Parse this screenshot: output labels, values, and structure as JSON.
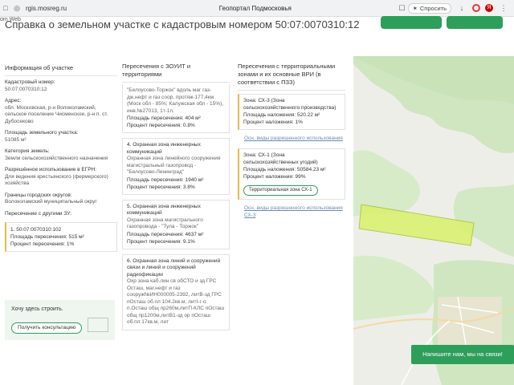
{
  "browser": {
    "url": "rgis.mosreg.ru",
    "tab_title": "Геопортал Подмосковья",
    "save_label": "Спросить",
    "web_label": "om Web"
  },
  "page": {
    "title": "Справка о земельном участке с кадастровым номером 50:07:0070310:12"
  },
  "col1": {
    "heading": "Информация об участке",
    "fields": [
      {
        "label": "Кадастровый номер:",
        "value": "50:07:0070310:12"
      },
      {
        "label": "Адрес:",
        "value": "обл. Московская, р-н Волоколамский, сельское поселение Чисменское, р-н п. ст. Дубосеково"
      },
      {
        "label": "Площадь земельного участка:",
        "value": "51085 м²"
      },
      {
        "label": "Категория земель:",
        "value": "Земли сельскохозяйственного назначения"
      },
      {
        "label": "Разрешённое использование в ЕГРН:",
        "value": "Для ведения крестьянского (фермерского) хозяйства"
      },
      {
        "label": "Границы городских округов:",
        "value": "Волоколамский муниципальный округ"
      }
    ],
    "overlap_title": "Пересечение с другими ЗУ:",
    "overlap_card": {
      "id": "1. 50:07:0070310:102",
      "area": "Площадь пересечения: 515 м²",
      "pct": "Процент пересечения: 1%"
    },
    "consult_text": "Хочу здесь строить.",
    "consult_button": "Получить консультацию"
  },
  "col2": {
    "heading": "Пересечения с ЗОУИТ и территориями",
    "cards": [
      {
        "title": "",
        "desc": "\"Белоусово-Торжок\" вдоль маг газ-дж.нефт и газ соор, протяж-177,4км (Моск обл - 85%; Калужская обл - 15%), инв.№27013, 1т-1п.",
        "area": "Площадь пересечения: 404 м²",
        "pct": "Процент пересечения: 0.8%"
      },
      {
        "title": "4. Охранная зона инженерных коммуникаций",
        "desc": "Охранная зона линейного сооружения магистральный газопровод - \"Белоусово-Ленинград\"",
        "area": "Площадь пересечения: 1940 м²",
        "pct": "Процент пересечения: 3.8%"
      },
      {
        "title": "5. Охранная зона инженерных коммуникаций",
        "desc": "Охранная зона магистрального газопровода - \"Тула - Торжок\"",
        "area": "Площадь пересечения: 4637 м²",
        "pct": "Процент пересечения: 9.1%"
      },
      {
        "title": "6. Охранная зона линий и сооружений связи и линий и сооружений радиофикации",
        "desc": "Охр зона каб.лин св обСТО и зд ГРС Осташ, маг.нефт и газ сооруж№ИН000005-2392, литВ-зд ГРС пОсташ об.пл 104.2кв.м, литI-г-о п.Осташ общ пр260м,литП-КЛС пОсташ общ пр1200м,литВ1-зд ор пОсташ об.пл 17кв.м, лит",
        "area": "",
        "pct": ""
      }
    ]
  },
  "col3": {
    "heading": "Пересечения с территориальными зонами и их основные ВРИ (в соответствии с ПЗЗ)",
    "cards": [
      {
        "title": "Зона: СХ-3 (Зона сельскохозяйственного производства)",
        "area": "Площадь наложения: 520.22 м²",
        "pct": "Процент наложения: 1%",
        "link": "Осн. виды разрешенного использования"
      },
      {
        "title": "Зона: СХ-1 (Зона сельскохозяйственных угодий)",
        "area": "Площадь наложения: 50584.23 м²",
        "pct": "Процент наложения: 99%",
        "pill": "Территориальная зона СХ-1",
        "link": "Осн. виды разрешенного использования СХ-3"
      }
    ]
  },
  "chat": {
    "label": "Напишите нам, мы на связи!"
  },
  "colors": {
    "accent": "#2e9e5b",
    "highlight": "#e9b949",
    "parcel": "#d9f26b"
  }
}
